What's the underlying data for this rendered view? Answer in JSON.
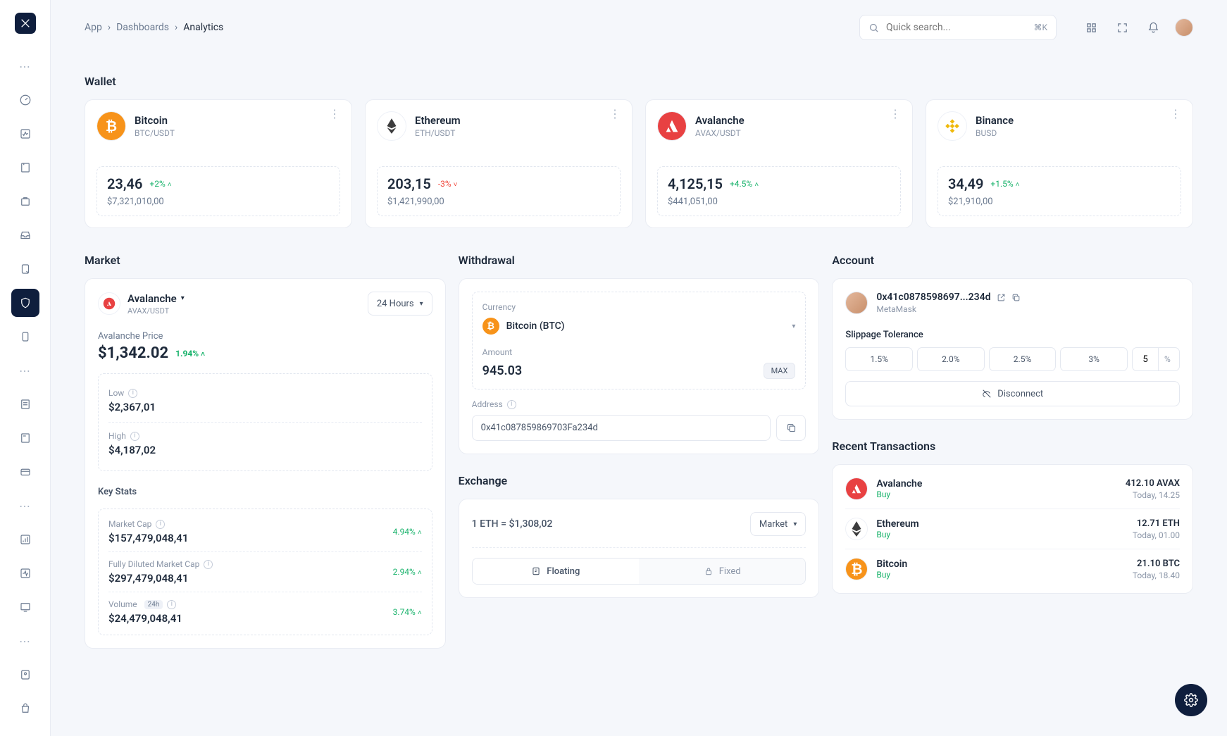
{
  "breadcrumb": {
    "app": "App",
    "dashboards": "Dashboards",
    "analytics": "Analytics"
  },
  "search": {
    "placeholder": "Quick search...",
    "kbd": "⌘K"
  },
  "sections": {
    "wallet": "Wallet",
    "market": "Market",
    "withdrawal": "Withdrawal",
    "account": "Account",
    "recent": "Recent Transactions",
    "exchange": "Exchange"
  },
  "wallet": [
    {
      "name": "Bitcoin",
      "pair": "BTC/USDT",
      "amount": "23,46",
      "delta": "+2%",
      "dir": "up",
      "usd": "$7,321,010,00",
      "color": "#f7931a"
    },
    {
      "name": "Ethereum",
      "pair": "ETH/USDT",
      "amount": "203,15",
      "delta": "-3%",
      "dir": "down",
      "usd": "$1,421,990,00",
      "color": "#3c3c3d"
    },
    {
      "name": "Avalanche",
      "pair": "AVAX/USDT",
      "amount": "4,125,15",
      "delta": "+4.5%",
      "dir": "up",
      "usd": "$441,051,00",
      "color": "#e84142"
    },
    {
      "name": "Binance",
      "pair": "BUSD",
      "amount": "34,49",
      "delta": "+1.5%",
      "dir": "up",
      "usd": "$21,910,00",
      "color": "#f0b90b"
    }
  ],
  "market": {
    "coin_name": "Avalanche",
    "coin_pair": "AVAX/USDT",
    "range": "24 Hours",
    "price_label": "Avalanche Price",
    "price": "$1,342.02",
    "price_delta": "1.94%",
    "low_label": "Low",
    "low": "$2,367,01",
    "high_label": "High",
    "high": "$4,187,02",
    "keystats_label": "Key Stats",
    "stats": [
      {
        "label": "Market Cap",
        "value": "$157,479,048,41",
        "delta": "4.94%",
        "badge": ""
      },
      {
        "label": "Fully Diluted Market Cap",
        "value": "$297,479,048,41",
        "delta": "2.94%",
        "badge": ""
      },
      {
        "label": "Volume",
        "value": "$24,479,048,41",
        "delta": "3.74%",
        "badge": "24h"
      }
    ]
  },
  "withdrawal": {
    "currency_label": "Currency",
    "currency": "Bitcoin (BTC)",
    "amount_label": "Amount",
    "amount": "945.03",
    "max": "MAX",
    "address_label": "Address",
    "address": "0x41c087859869703Fa234d"
  },
  "exchange": {
    "rate": "1 ETH = $1,308,02",
    "market_btn": "Market",
    "floating": "Floating",
    "fixed": "Fixed"
  },
  "account": {
    "address": "0x41c0878598697...234d",
    "wallet": "MetaMask",
    "slip_label": "Slippage Tolerance",
    "slip_opts": [
      "1.5%",
      "2.0%",
      "2.5%",
      "3%"
    ],
    "slip_custom": "5",
    "pct": "%",
    "disconnect": "Disconnect"
  },
  "transactions": [
    {
      "name": "Avalanche",
      "type": "Buy",
      "amount": "412.10 AVAX",
      "time": "Today, 14.25",
      "color": "#e84142"
    },
    {
      "name": "Ethereum",
      "type": "Buy",
      "amount": "12.71 ETH",
      "time": "Today, 01.00",
      "color": "#3c3c3d"
    },
    {
      "name": "Bitcoin",
      "type": "Buy",
      "amount": "21.10 BTC",
      "time": "Today, 18.40",
      "color": "#f7931a"
    }
  ]
}
